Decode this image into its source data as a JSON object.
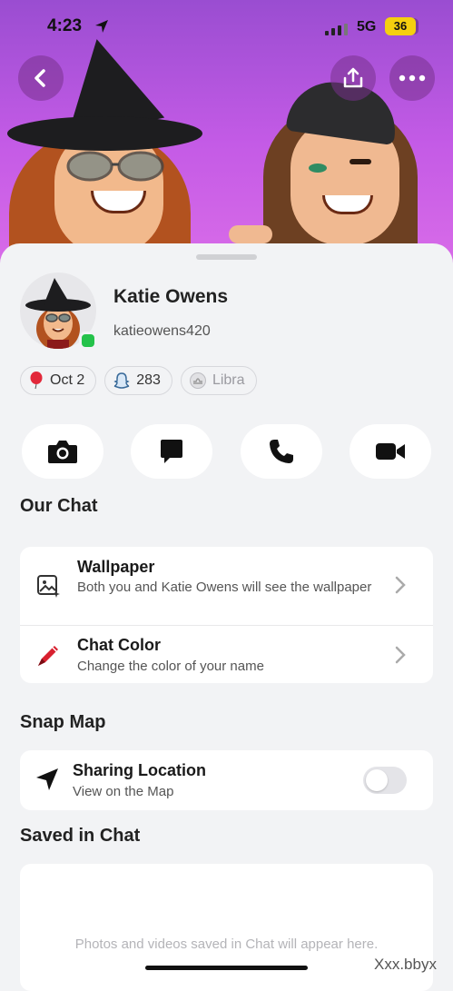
{
  "status_bar": {
    "time": "4:23",
    "network": "5G",
    "battery": "36"
  },
  "header": {
    "back_icon": "chevron-left-icon",
    "share_icon": "share-icon",
    "more_icon": "more-icon"
  },
  "profile": {
    "name": "Katie Owens",
    "username": "katieowens420",
    "online": true,
    "chips": [
      {
        "icon": "balloon-icon",
        "label": "Oct 2"
      },
      {
        "icon": "snapstreak-ghost-icon",
        "label": "283"
      },
      {
        "icon": "libra-icon",
        "label": "Libra"
      }
    ]
  },
  "actions": [
    "camera-icon",
    "chat-icon",
    "phone-icon",
    "video-icon"
  ],
  "our_chat": {
    "title": "Our Chat",
    "wallpaper": {
      "title": "Wallpaper",
      "subtitle": "Both you and Katie Owens will see the wallpaper"
    },
    "chat_color": {
      "title": "Chat Color",
      "subtitle": "Change the color of your name"
    }
  },
  "snap_map": {
    "title": "Snap Map",
    "sharing": {
      "title": "Sharing Location",
      "subtitle": "View on the Map",
      "enabled": false
    }
  },
  "saved_in_chat": {
    "title": "Saved in Chat",
    "empty_text": "Photos and videos saved in Chat will appear here."
  },
  "watermark": "Xxx.bbyx",
  "colors": {
    "hero_top": "#9a4dd1",
    "hero_bottom": "#d86be8",
    "online": "#24c24a",
    "battery": "#f5d00f"
  }
}
